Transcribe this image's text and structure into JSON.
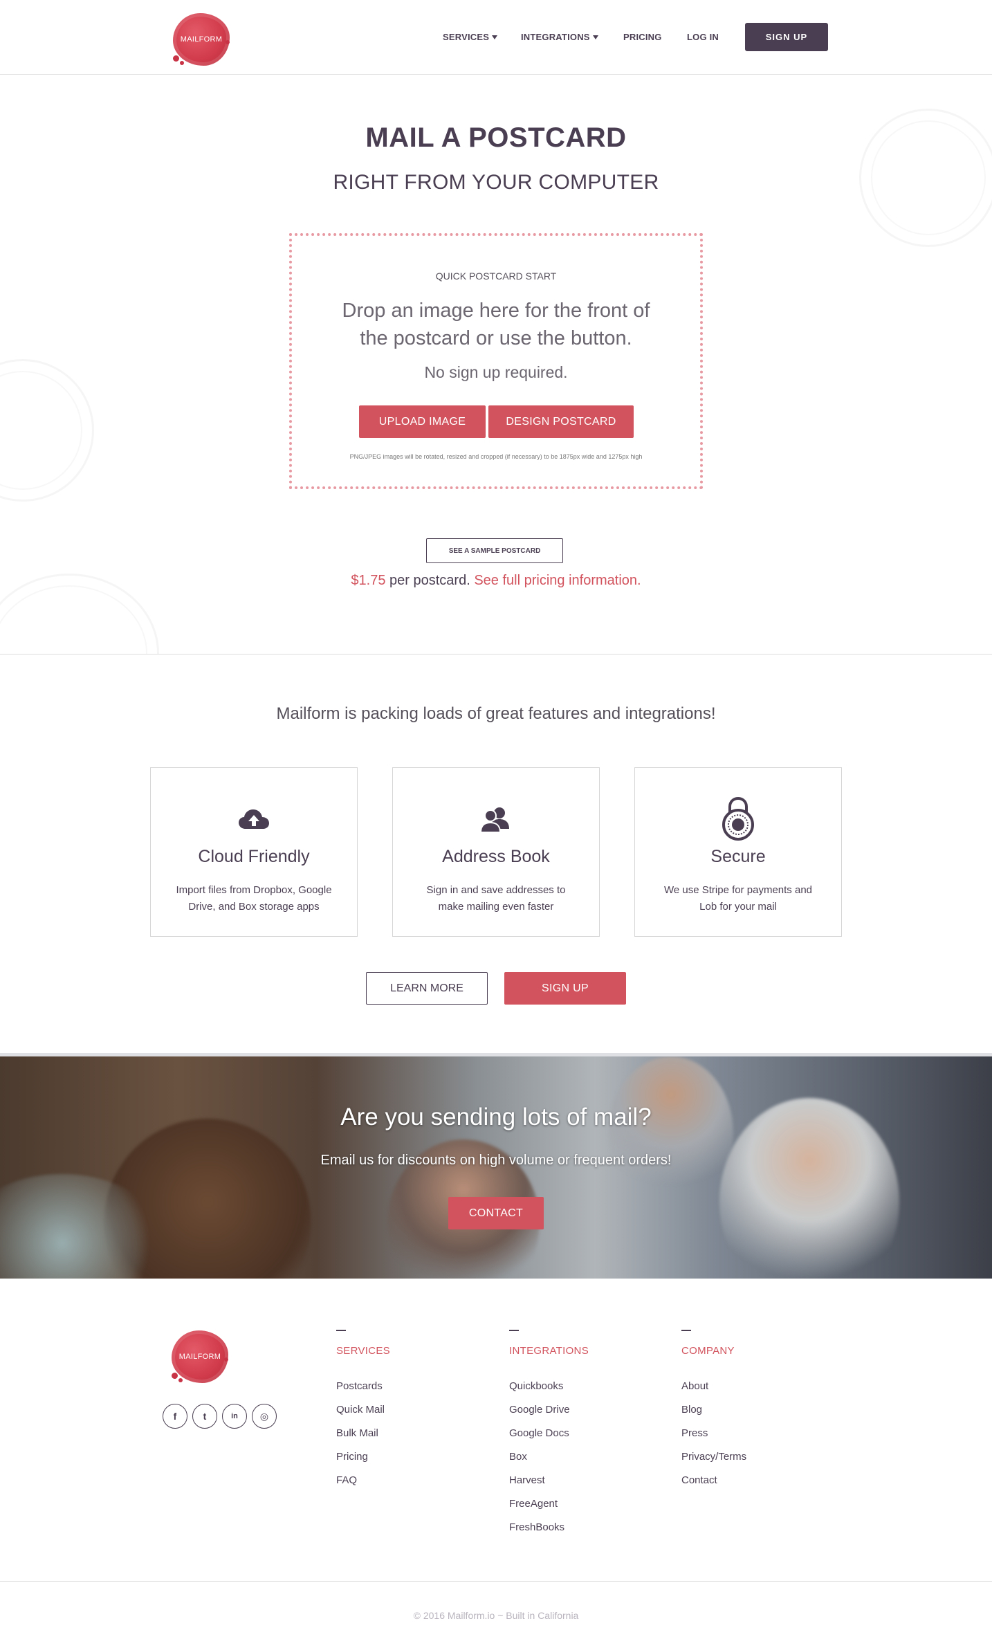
{
  "brand": {
    "name": "MAILFORM"
  },
  "nav": {
    "items": [
      {
        "label": "SERVICES",
        "dropdown": true
      },
      {
        "label": "INTEGRATIONS",
        "dropdown": true
      },
      {
        "label": "PRICING",
        "dropdown": false
      },
      {
        "label": "LOG IN",
        "dropdown": false
      }
    ],
    "signup_label": "SIGN UP"
  },
  "hero": {
    "title": "MAIL A POSTCARD",
    "subtitle": "RIGHT FROM YOUR COMPUTER",
    "dropzone": {
      "label": "QUICK POSTCARD START",
      "main_text": "Drop an image here for the front of the postcard or use the button.",
      "note": "No sign up required.",
      "upload_label": "UPLOAD IMAGE",
      "design_label": "DESIGN POSTCARD",
      "fine_print": "PNG/JPEG images will be rotated, resized and cropped (if necessary) to be 1875px wide and 1275px high"
    },
    "sample_label": "SEE A SAMPLE POSTCARD",
    "price": "$1.75",
    "price_text": " per postcard. ",
    "pricing_link": "See full pricing information."
  },
  "features": {
    "title": "Mailform is packing loads of great features and integrations!",
    "cards": [
      {
        "icon": "cloud-upload-icon",
        "title": "Cloud Friendly",
        "desc": "Import files from Dropbox, Google Drive, and Box storage apps"
      },
      {
        "icon": "address-book-icon",
        "title": "Address Book",
        "desc": "Sign in and save addresses to make mailing even faster"
      },
      {
        "icon": "lock-icon",
        "title": "Secure",
        "desc": "We use Stripe for payments and Lob for your mail"
      }
    ],
    "learn_more_label": "LEARN MORE",
    "signup_label": "SIGN UP"
  },
  "banner": {
    "title": "Are you sending lots of mail?",
    "subtitle": "Email us for discounts on high volume or frequent orders!",
    "contact_label": "CONTACT"
  },
  "footer": {
    "social": [
      {
        "icon": "facebook-icon",
        "glyph": "f"
      },
      {
        "icon": "twitter-icon",
        "glyph": "t"
      },
      {
        "icon": "linkedin-icon",
        "glyph": "in"
      },
      {
        "icon": "instagram-icon",
        "glyph": "◎"
      }
    ],
    "columns": [
      {
        "heading": "SERVICES",
        "links": [
          "Postcards",
          "Quick Mail",
          "Bulk Mail",
          "Pricing",
          "FAQ"
        ]
      },
      {
        "heading": "INTEGRATIONS",
        "links": [
          "Quickbooks",
          "Google Drive",
          "Google Docs",
          "Box",
          "Harvest",
          "FreeAgent",
          "FreshBooks"
        ]
      },
      {
        "heading": "COMPANY",
        "links": [
          "About",
          "Blog",
          "Press",
          "Privacy/Terms",
          "Contact"
        ]
      }
    ],
    "copyright": "© 2016 Mailform.io ~ Built in California"
  },
  "colors": {
    "accent": "#d2535d",
    "dark": "#4a3f52",
    "dropzone_border": "#e89aa3"
  }
}
